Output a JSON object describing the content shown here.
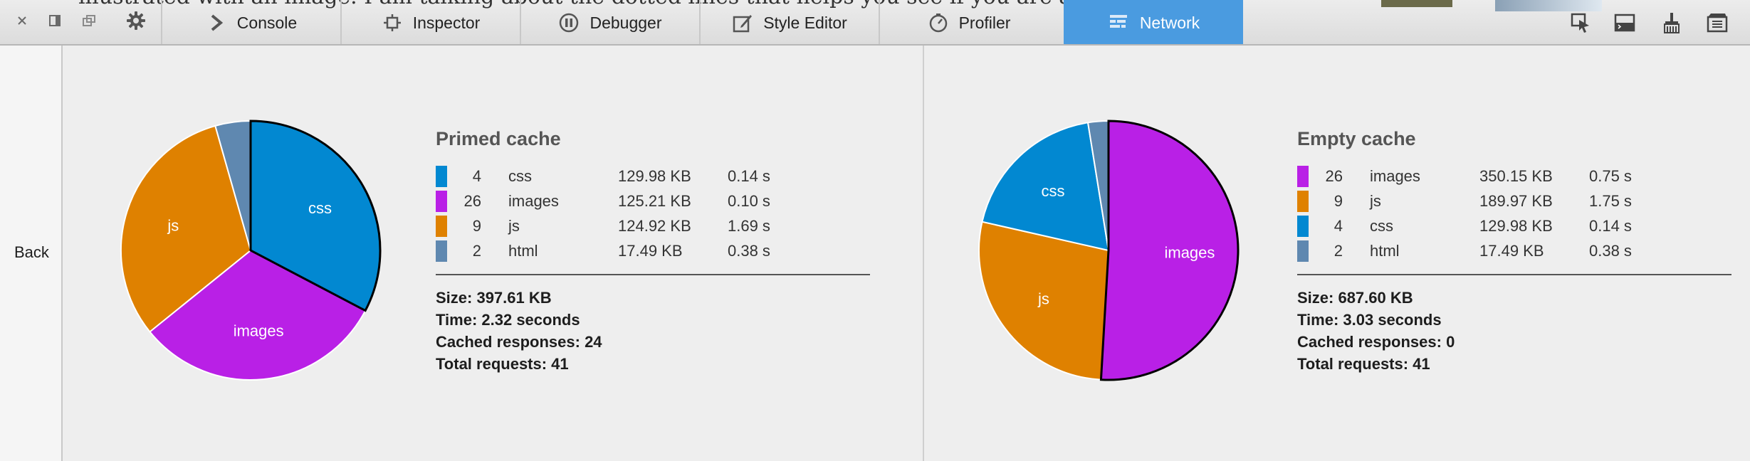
{
  "background_text": "illustrated with an image. I am talking about the dotted lines that helps you see if you are aligned with",
  "window_controls": {
    "close": "close-icon",
    "dock": "dock-side-icon",
    "undock": "separate-window-icon",
    "settings": "gear-icon"
  },
  "tabs": [
    {
      "label": "Console",
      "icon": "chevron-right-icon"
    },
    {
      "label": "Inspector",
      "icon": "inspector-box-icon"
    },
    {
      "label": "Debugger",
      "icon": "pause-icon"
    },
    {
      "label": "Style Editor",
      "icon": "pencil-icon"
    },
    {
      "label": "Profiler",
      "icon": "stopwatch-icon"
    },
    {
      "label": "Network",
      "icon": "network-icon",
      "active": true
    }
  ],
  "right_icons": [
    "pick-element-icon",
    "split-console-icon",
    "paintbrush-icon",
    "screenshot-icon"
  ],
  "sidebar": {
    "back_label": "Back"
  },
  "colors": {
    "css": "#0288d1",
    "images": "#b920e6",
    "js": "#df8100",
    "html": "#5f88b0",
    "active_tab": "#4a9be0"
  },
  "primed": {
    "title": "Primed cache",
    "rows": [
      {
        "count": "4",
        "name": "css",
        "size": "129.98 KB",
        "time": "0.14 s",
        "color": "#0288d1"
      },
      {
        "count": "26",
        "name": "images",
        "size": "125.21 KB",
        "time": "0.10 s",
        "color": "#b920e6"
      },
      {
        "count": "9",
        "name": "js",
        "size": "124.92 KB",
        "time": "1.69 s",
        "color": "#df8100"
      },
      {
        "count": "2",
        "name": "html",
        "size": "17.49 KB",
        "time": "0.38 s",
        "color": "#5f88b0"
      }
    ],
    "summary": {
      "size": "Size: 397.61 KB",
      "time": "Time: 2.32 seconds",
      "cached": "Cached responses: 24",
      "total": "Total requests: 41"
    }
  },
  "empty": {
    "title": "Empty cache",
    "rows": [
      {
        "count": "26",
        "name": "images",
        "size": "350.15 KB",
        "time": "0.75 s",
        "color": "#b920e6"
      },
      {
        "count": "9",
        "name": "js",
        "size": "189.97 KB",
        "time": "1.75 s",
        "color": "#df8100"
      },
      {
        "count": "4",
        "name": "css",
        "size": "129.98 KB",
        "time": "0.14 s",
        "color": "#0288d1"
      },
      {
        "count": "2",
        "name": "html",
        "size": "17.49 KB",
        "time": "0.38 s",
        "color": "#5f88b0"
      }
    ],
    "summary": {
      "size": "Size: 687.60 KB",
      "time": "Time: 3.03 seconds",
      "cached": "Cached responses: 0",
      "total": "Total requests: 41"
    }
  },
  "chart_data": [
    {
      "type": "pie",
      "slices": [
        {
          "label": "css",
          "value": 129.98,
          "color": "#0288d1",
          "highlighted": true
        },
        {
          "label": "images",
          "value": 125.21,
          "color": "#b920e6"
        },
        {
          "label": "js",
          "value": 124.92,
          "color": "#df8100"
        },
        {
          "label": "html",
          "value": 17.49,
          "color": "#5f88b0"
        }
      ]
    },
    {
      "type": "pie",
      "slices": [
        {
          "label": "images",
          "value": 350.15,
          "color": "#b920e6",
          "highlighted": true
        },
        {
          "label": "js",
          "value": 189.97,
          "color": "#df8100"
        },
        {
          "label": "css",
          "value": 129.98,
          "color": "#0288d1"
        },
        {
          "label": "html",
          "value": 17.49,
          "color": "#5f88b0"
        }
      ]
    }
  ]
}
